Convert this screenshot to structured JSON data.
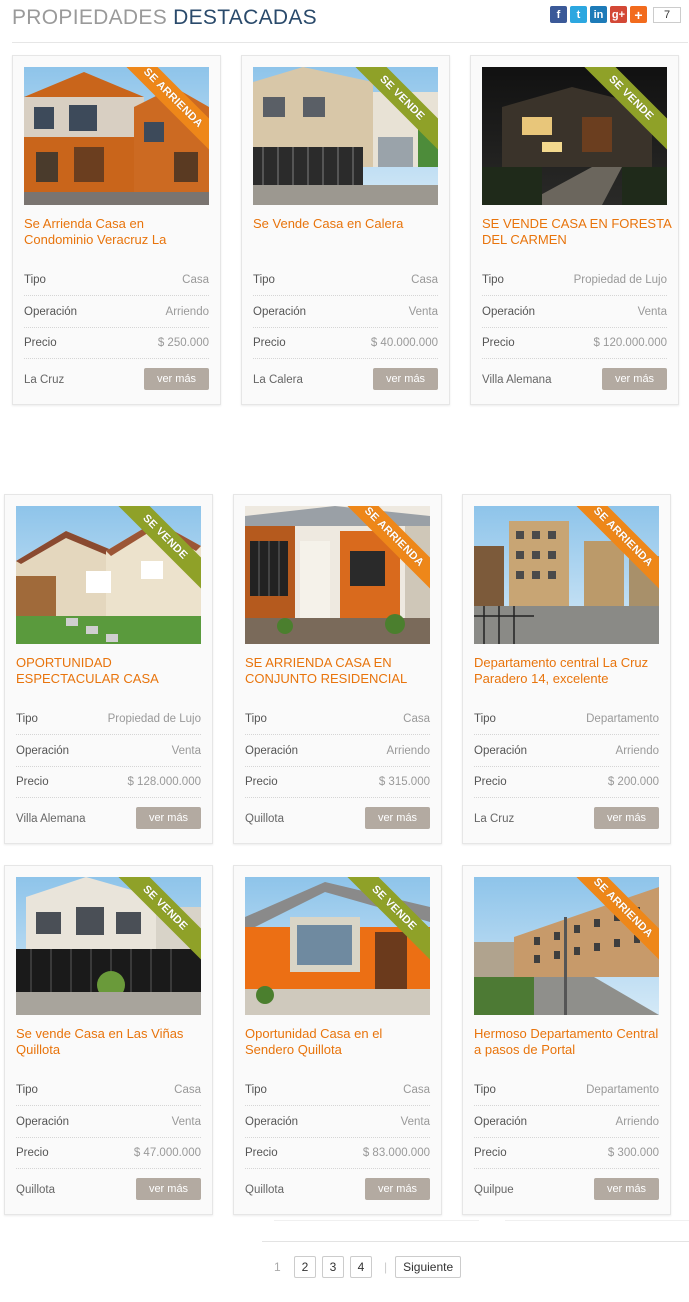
{
  "header": {
    "title_light": "PROPIEDADES",
    "title_dark": "DESTACADAS",
    "share_icons": [
      "facebook-icon",
      "twitter-icon",
      "linkedin-icon",
      "google-plus-icon",
      "addthis-plus-icon"
    ],
    "share_count": "7"
  },
  "labels": {
    "tipo": "Tipo",
    "operacion": "Operación",
    "precio": "Precio",
    "ver_mas": "ver más"
  },
  "colors": {
    "accent_title": "#e8740c",
    "ribbon_vende": "#8fa128",
    "ribbon_arrienda": "#ee8719",
    "button": "#b3aaa1",
    "heading_dark": "#2a4a6b"
  },
  "listings": [
    {
      "ribbon": "SE ARRIENDA",
      "title": "Se Arrienda Casa en Condominio Veracruz La",
      "tipo": "Casa",
      "operacion": "Arriendo",
      "precio": "$ 250.000",
      "location": "La Cruz"
    },
    {
      "ribbon": "SE VENDE",
      "title": "Se Vende Casa en Calera",
      "tipo": "Casa",
      "operacion": "Venta",
      "precio": "$ 40.000.000",
      "location": "La Calera"
    },
    {
      "ribbon": "SE VENDE",
      "title": "SE VENDE CASA EN FORESTA DEL CARMEN",
      "tipo": "Propiedad de Lujo",
      "operacion": "Venta",
      "precio": "$ 120.000.000",
      "location": "Villa Alemana"
    },
    {
      "ribbon": "SE VENDE",
      "title": "OPORTUNIDAD ESPECTACULAR CASA",
      "tipo": "Propiedad de Lujo",
      "operacion": "Venta",
      "precio": "$ 128.000.000",
      "location": "Villa Alemana"
    },
    {
      "ribbon": "SE ARRIENDA",
      "title": "SE ARRIENDA CASA EN CONJUNTO RESIDENCIAL",
      "tipo": "Casa",
      "operacion": "Arriendo",
      "precio": "$ 315.000",
      "location": "Quillota"
    },
    {
      "ribbon": "SE ARRIENDA",
      "title": "Departamento central La Cruz Paradero 14, excelente",
      "tipo": "Departamento",
      "operacion": "Arriendo",
      "precio": "$ 200.000",
      "location": "La Cruz"
    },
    {
      "ribbon": "SE VENDE",
      "title": "Se vende Casa en Las Viñas Quillota",
      "tipo": "Casa",
      "operacion": "Venta",
      "precio": "$ 47.000.000",
      "location": "Quillota"
    },
    {
      "ribbon": "SE VENDE",
      "title": "Oportunidad Casa en el Sendero Quillota",
      "tipo": "Casa",
      "operacion": "Venta",
      "precio": "$ 83.000.000",
      "location": "Quillota"
    },
    {
      "ribbon": "SE ARRIENDA",
      "title": "Hermoso Departamento Central a pasos de Portal",
      "tipo": "Departamento",
      "operacion": "Arriendo",
      "precio": "$ 300.000",
      "location": "Quilpue"
    }
  ],
  "pagination": {
    "current": "1",
    "pages": [
      "2",
      "3",
      "4"
    ],
    "separator": "|",
    "next": "Siguiente"
  }
}
